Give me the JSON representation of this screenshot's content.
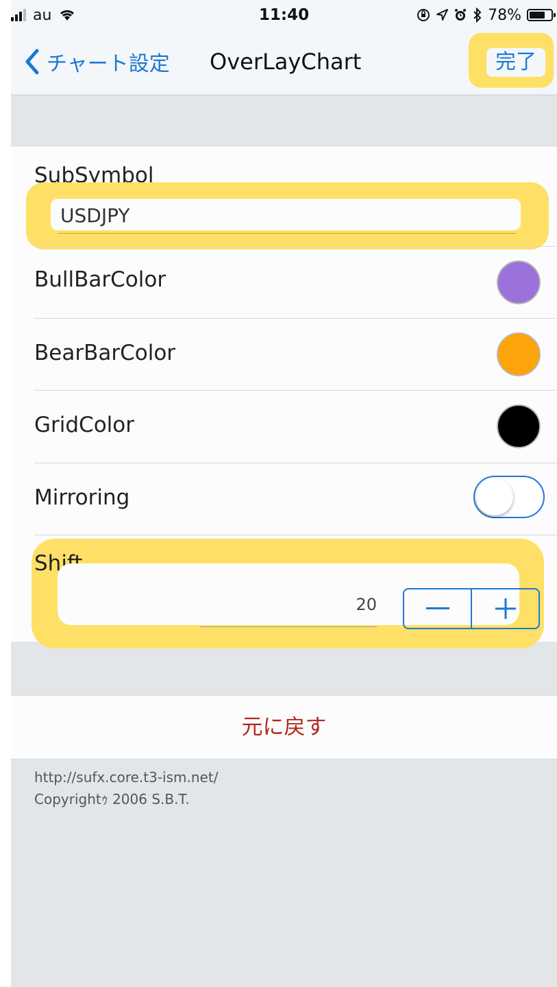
{
  "status_bar": {
    "carrier": "au",
    "time": "11:40",
    "battery": "78%",
    "battery_level": 0.78
  },
  "nav": {
    "back_label": "チャート設定",
    "title": "OverLayChart",
    "done_label": "完了"
  },
  "settings": {
    "subsymbol": {
      "label": "SubSymbol",
      "value": "USDJPY"
    },
    "bull_bar_color": {
      "label": "BullBarColor",
      "color": "#9a72da"
    },
    "bear_bar_color": {
      "label": "BearBarColor",
      "color": "#fea40b"
    },
    "grid_color": {
      "label": "GridColor",
      "color": "#000000"
    },
    "mirroring": {
      "label": "Mirroring",
      "on": false
    },
    "shift": {
      "label": "Shift",
      "value": "20",
      "minus": "−",
      "plus": "+"
    }
  },
  "reset_label": "元に戻す",
  "footer": {
    "url": "http://sufx.core.t3-ism.net/",
    "copyright": "Copyrightｩ 2006 S.B.T."
  },
  "colors": {
    "accent": "#1a78d6",
    "highlight": "#ffe066",
    "destructive": "#b3271c"
  }
}
